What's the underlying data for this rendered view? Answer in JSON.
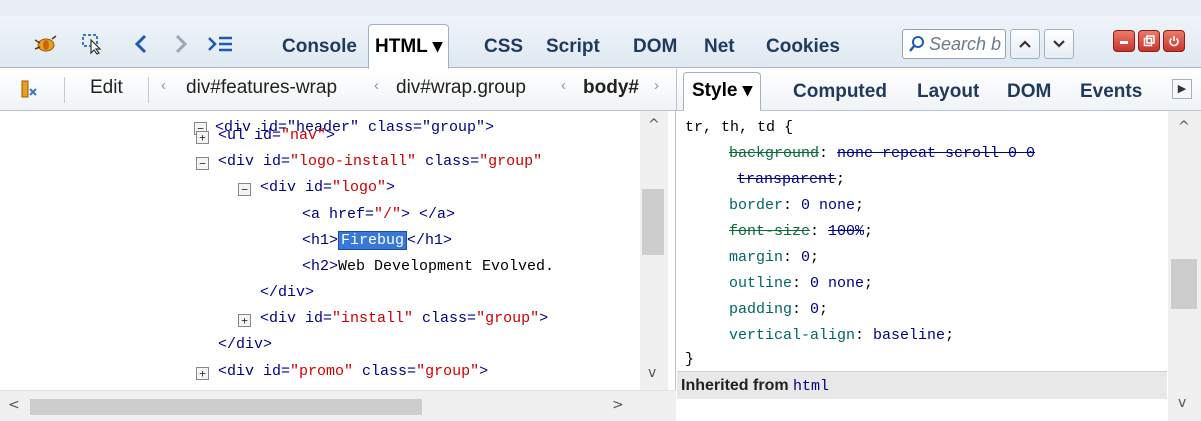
{
  "toolbar": {
    "tabs": [
      "Console",
      "HTML",
      "CSS",
      "Script",
      "DOM",
      "Net",
      "Cookies"
    ],
    "html_tab_label": "HTML ▾",
    "search_placeholder": "Search b"
  },
  "breadcrumb": {
    "edit_label": "Edit",
    "items": [
      "div#features-wrap",
      "div#wrap.group",
      "body#"
    ]
  },
  "side_tabs": {
    "style_label": "Style ▾",
    "computed": "Computed",
    "layout": "Layout",
    "dom": "DOM",
    "events": "Events"
  },
  "html_tree": {
    "top_partial": "<div id=\"header\" class=\"group\">",
    "lines": [
      {
        "pre": "<ul ",
        "attr": "id=",
        "val": "\"nav\"",
        "post": ">"
      },
      {
        "pre": "<div ",
        "attr": "id=",
        "val": "\"logo-install\"",
        "attr2": " class=",
        "val2": "\"group\"",
        "post": ""
      },
      {
        "pre": "<div ",
        "attr": "id=",
        "val": "\"logo\"",
        "post": ">"
      },
      {
        "pre": "<a ",
        "attr": "href=",
        "val": "\"/\"",
        "post": "> </a>"
      },
      {
        "pre": "<h1>",
        "selected": "Firebug",
        "post": "</h1>"
      },
      {
        "pre": "<h2>",
        "text": "Web Development Evolved.",
        "post": ""
      },
      {
        "pre": "</div>",
        "post": ""
      },
      {
        "pre": "<div ",
        "attr": "id=",
        "val": "\"install\"",
        "attr2": " class=",
        "val2": "\"group\"",
        "post": ">"
      },
      {
        "pre": "</div>",
        "post": ""
      },
      {
        "pre": "<div ",
        "attr": "id=",
        "val": "\"promo\"",
        "attr2": " class=",
        "val2": "\"group\"",
        "post": ">"
      }
    ]
  },
  "style_rule": {
    "selector": "tr, th, td {",
    "decls": [
      {
        "prop": "background",
        "value": "none repeat scroll 0 0",
        "overridden": true
      },
      {
        "prop": "",
        "value": "transparent",
        "overridden": true
      },
      {
        "prop": "border",
        "value": "0 none",
        "overridden": false
      },
      {
        "prop": "font-size",
        "value": "100%",
        "overridden": true
      },
      {
        "prop": "margin",
        "value": "0",
        "overridden": false
      },
      {
        "prop": "outline",
        "value": "0 none",
        "overridden": false
      },
      {
        "prop": "padding",
        "value": "0",
        "overridden": false
      },
      {
        "prop": "vertical-align",
        "value": "baseline",
        "overridden": false
      }
    ],
    "close": "}"
  },
  "inherited": {
    "label": "Inherited from",
    "element": "html"
  }
}
